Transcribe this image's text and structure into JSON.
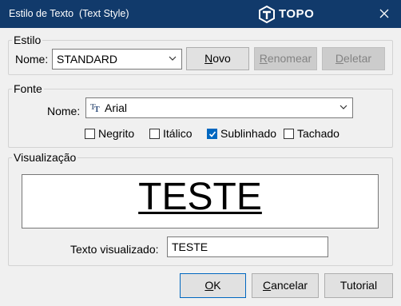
{
  "window": {
    "title": "Estilo de Texto  (Text Style)",
    "logo_text": "TOPO",
    "close_icon": "close-icon"
  },
  "style_group": {
    "legend": "Estilo",
    "name_label": "Nome:",
    "name_value": "STANDARD",
    "new_button": {
      "accel": "N",
      "rest": "ovo"
    },
    "rename_button": {
      "accel": "R",
      "rest": "enomear"
    },
    "delete_button": {
      "accel": "D",
      "rest": "eletar"
    }
  },
  "font_group": {
    "legend": "Fonte",
    "name_label": "Nome:",
    "font_icon": "truetype-font-icon",
    "font_value": "Arial",
    "options": [
      {
        "label": "Negrito",
        "checked": false
      },
      {
        "label": "Itálico",
        "checked": false
      },
      {
        "label": "Sublinhado",
        "checked": true
      },
      {
        "label": "Tachado",
        "checked": false
      }
    ]
  },
  "preview_group": {
    "legend": "Visualização",
    "preview_text": "TESTE",
    "preview_label": "Texto visualizado:",
    "preview_input_value": "TESTE"
  },
  "footer": {
    "ok_button": {
      "accel": "O",
      "rest": "K"
    },
    "cancel_button": {
      "accel": "C",
      "rest": "ancelar"
    },
    "tutorial_button": "Tutorial"
  },
  "colors": {
    "titlebar": "#113a6b",
    "checkbox_checked": "#0067c0"
  }
}
